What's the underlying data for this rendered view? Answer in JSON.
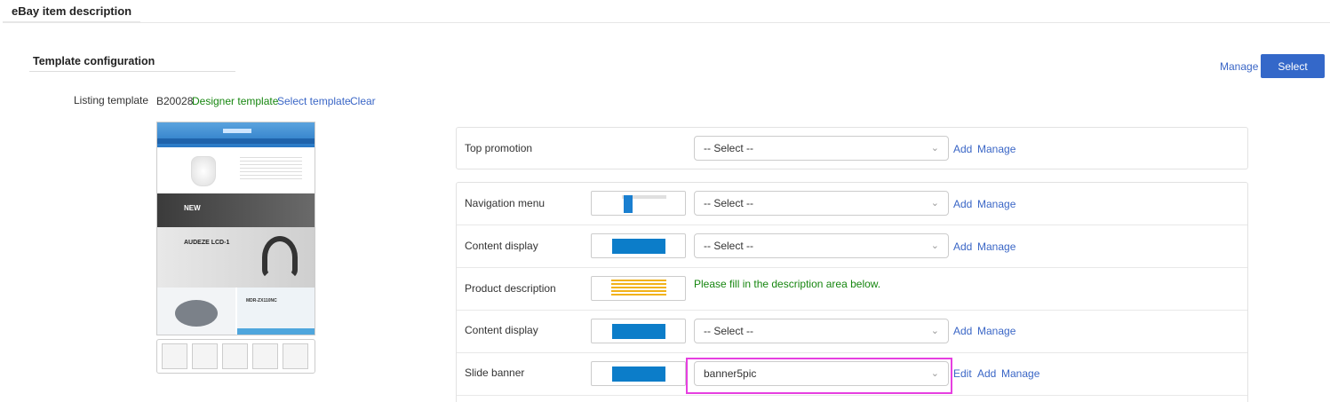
{
  "page": {
    "title": "eBay item description"
  },
  "section": {
    "title": "Template configuration"
  },
  "toolbar": {
    "manage_label": "Manage",
    "select_label": "Select"
  },
  "listing_template": {
    "label": "Listing template",
    "code": "B20028",
    "type": "Designer template",
    "select_label": "Select template",
    "clear_label": "Clear"
  },
  "preview": {
    "band1_text": "NEW",
    "band2_text": "AUDEZE LCD-1",
    "bottom_right_text": "MDR-ZX110NC"
  },
  "top_promotion": {
    "label": "Top promotion",
    "value": "-- Select --",
    "add_label": "Add",
    "manage_label": "Manage"
  },
  "modules": [
    {
      "label": "Navigation menu",
      "value": "-- Select --",
      "add_label": "Add",
      "manage_label": "Manage"
    },
    {
      "label": "Content display",
      "value": "-- Select --",
      "add_label": "Add",
      "manage_label": "Manage"
    },
    {
      "label": "Product description",
      "hint": "Please fill in the description area below."
    },
    {
      "label": "Content display",
      "value": "-- Select --",
      "add_label": "Add",
      "manage_label": "Manage"
    },
    {
      "label": "Slide banner",
      "value": "banner5pic",
      "edit_label": "Edit",
      "add_label": "Add",
      "manage_label": "Manage"
    }
  ],
  "colors": {
    "accent": "#3468c9",
    "link": "#3a66c6",
    "success_text": "#16860f",
    "highlight": "#e63fe0"
  },
  "icons": {
    "dropdown": "chevron-down-icon"
  }
}
